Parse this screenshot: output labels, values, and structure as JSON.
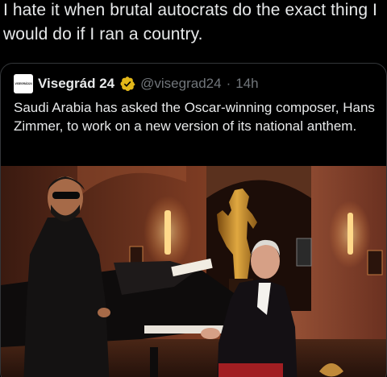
{
  "post": {
    "text": "I hate it when brutal autocrats do the exact thing I would do if I ran a country."
  },
  "quote": {
    "avatar_text": "VISEGRÁD24",
    "display_name": "Visegrád 24",
    "handle": "@visegrad24",
    "separator": "·",
    "time": "14h",
    "text": "Saudi Arabia has asked the Oscar-winning composer, Hans Zimmer, to work on a new version of its national anthem."
  },
  "colors": {
    "verified_badge": "#e2b719",
    "secondary_text": "#71767b",
    "border": "#333639"
  }
}
